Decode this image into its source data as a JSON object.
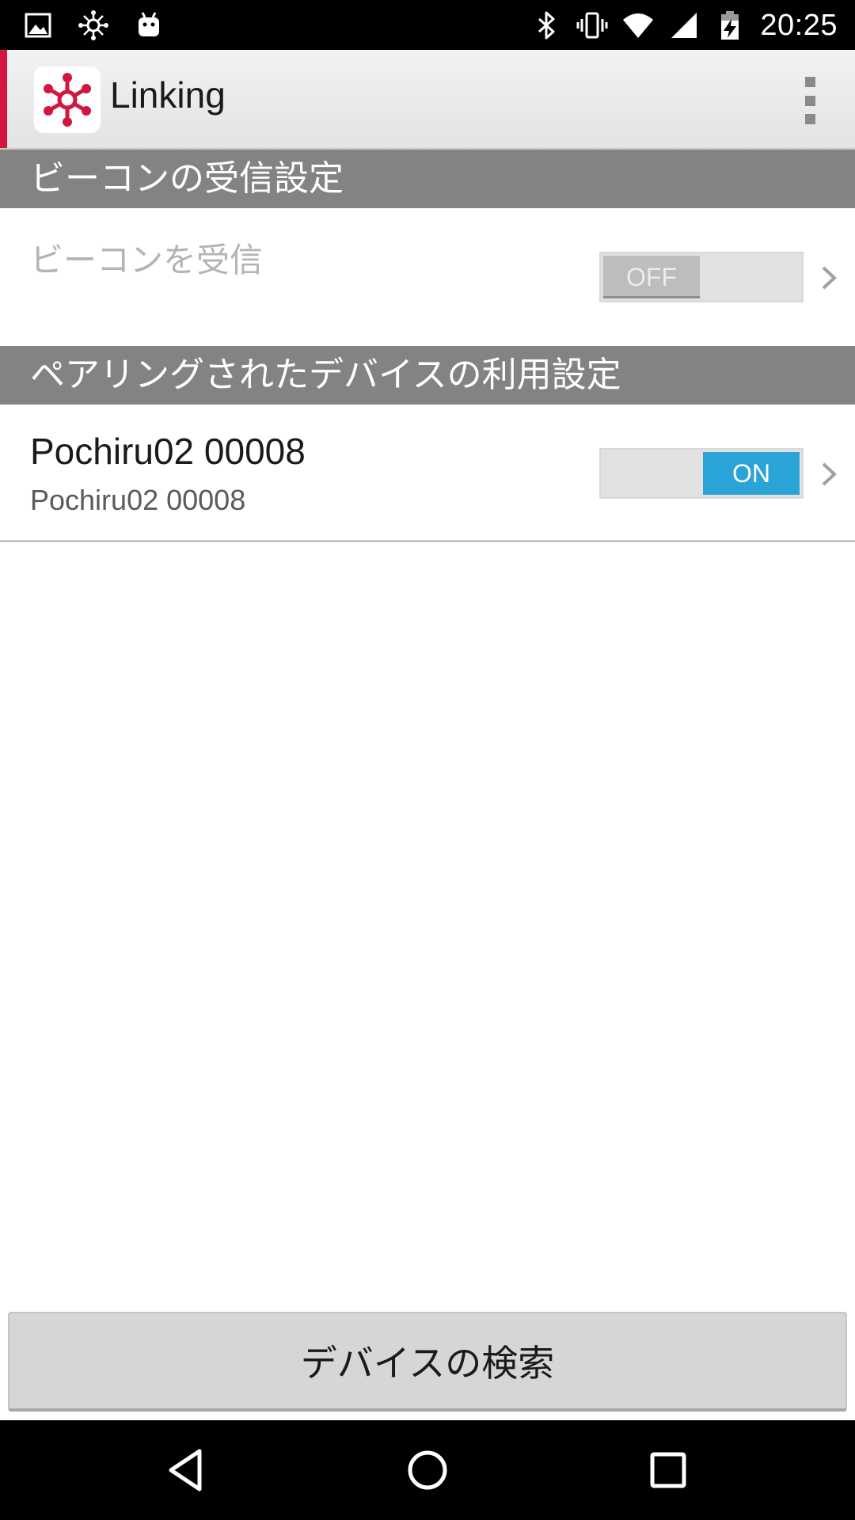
{
  "status_bar": {
    "time": "20:25",
    "left_icons": [
      "image-icon",
      "linking-notification-icon",
      "android-icon"
    ],
    "right_icons": [
      "bluetooth-icon",
      "vibrate-icon",
      "wifi-icon",
      "cell-signal-icon",
      "battery-charging-icon"
    ]
  },
  "action_bar": {
    "title": "Linking",
    "accent_color": "#d21640",
    "overflow_icon": "more-vertical-icon"
  },
  "sections": {
    "beacon": {
      "header": "ビーコンの受信設定",
      "row": {
        "title": "ビーコンを受信",
        "toggle_label": "OFF",
        "enabled": false
      }
    },
    "paired": {
      "header": "ペアリングされたデバイスの利用設定",
      "devices": [
        {
          "title": "Pochiru02 00008",
          "subtitle": "Pochiru02 00008",
          "toggle_label": "ON",
          "enabled": true
        }
      ]
    }
  },
  "colors": {
    "section_header_bg": "#838383",
    "toggle_on": "#2aa3d6",
    "toggle_off": "#bdbdbd"
  },
  "search_button": {
    "label": "デバイスの検索"
  },
  "nav_bar": {
    "icons": [
      "back-icon",
      "home-icon",
      "recents-icon"
    ]
  }
}
